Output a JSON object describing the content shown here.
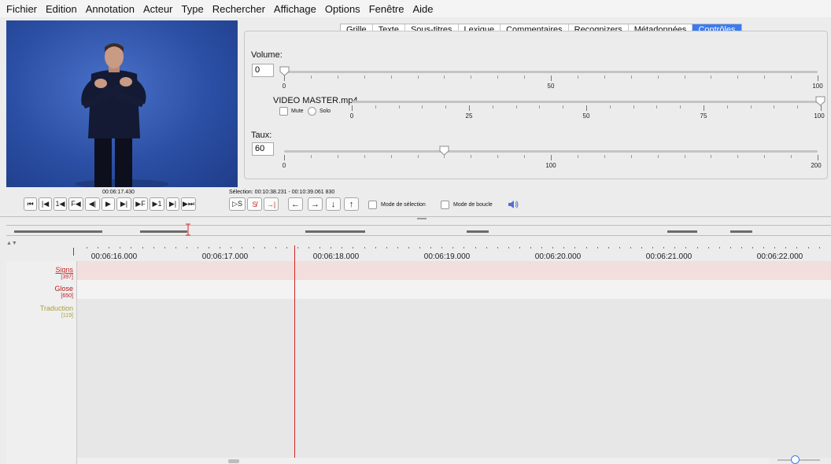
{
  "menu": [
    "Fichier",
    "Edition",
    "Annotation",
    "Acteur",
    "Type",
    "Rechercher",
    "Affichage",
    "Options",
    "Fenêtre",
    "Aide"
  ],
  "tabs": [
    "Grille",
    "Texte",
    "Sous-titres",
    "Lexique",
    "Commentaires",
    "Recognizers",
    "Métadonnées",
    "Contrôles"
  ],
  "active_tab": "Contrôles",
  "controls": {
    "volume_label": "Volume:",
    "volume_value": "0",
    "volume_ticks": [
      "0",
      "50",
      "100"
    ],
    "volume_level_percent": 0,
    "media_name": "VIDEO MASTER.mp4",
    "mute_label": "Mute",
    "solo_label": "Solo",
    "media_ticks": [
      "0",
      "25",
      "50",
      "75",
      "100"
    ],
    "media_level_percent": 100,
    "rate_label": "Taux:",
    "rate_value": "60",
    "rate_ticks": [
      "0",
      "100",
      "200"
    ],
    "rate_level_percent": 30
  },
  "player": {
    "current_time": "00:06:17.430",
    "selection": "Sélection: 00:10:38.231 - 00:10:39.061  830",
    "buttons": [
      "⏮",
      "|◀",
      "1◀",
      "F◀",
      "◀|",
      "▶",
      "▶|",
      "▶F",
      "▶1",
      "▶|",
      "▶⏭"
    ],
    "sel_buttons": [
      "▷S",
      "S̸",
      "→|"
    ],
    "nav_buttons": [
      "←",
      "→",
      "↓",
      "↑"
    ],
    "selection_mode_label": "Mode de sélection",
    "loop_mode_label": "Mode de boucle"
  },
  "timeline": {
    "times": [
      "00:06:16.000",
      "00:06:17.000",
      "00:06:18.000",
      "00:06:19.000",
      "00:06:20.000",
      "00:06:21.000",
      "00:06:22.000"
    ],
    "tiers": [
      {
        "name": "Signs",
        "count": "[397]",
        "color": "#c62828",
        "row_color": "#f3dede"
      },
      {
        "name": "Glose",
        "count": "[650]",
        "color": "#b71c1c",
        "row_color": "#f3f3f3"
      },
      {
        "name": "Traduction",
        "count": "[119]",
        "color": "#a8a042",
        "row_color": "#e7e7e7"
      }
    ]
  },
  "colors": {
    "accent": "#3a7cf0",
    "cursor": "#d42626"
  }
}
